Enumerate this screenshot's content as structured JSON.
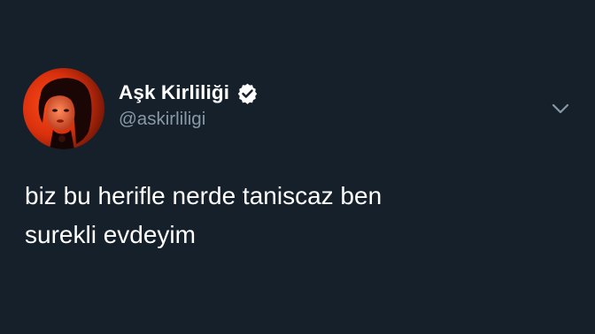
{
  "tweet": {
    "author": {
      "display_name": "Aşk Kirliliği",
      "handle": "@askirliligi",
      "verified": true,
      "avatar_icon": "profile-photo-avatar"
    },
    "text_lines": [
      "biz bu herifle nerde taniscaz ben",
      "surekli evdeyim"
    ],
    "more_icon": "chevron-down-icon"
  },
  "colors": {
    "background": "#15202b",
    "text_primary": "#ffffff",
    "text_secondary": "#8899a6"
  }
}
